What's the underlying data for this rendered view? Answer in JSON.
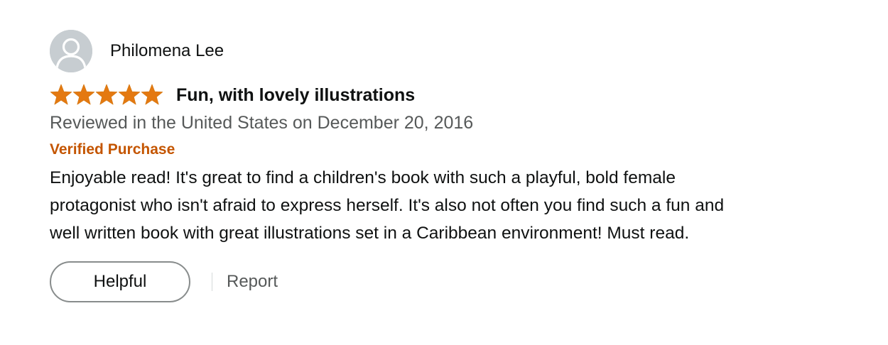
{
  "reviewer": {
    "name": "Philomena Lee",
    "avatar_icon": "default-user-avatar-icon"
  },
  "review": {
    "rating": 5,
    "rating_max": 5,
    "star_icon": "star-icon",
    "star_color": "#e47911",
    "title": "Fun, with lovely illustrations",
    "date_text": "Reviewed in the United States on December 20, 2016",
    "verified_label": "Verified Purchase",
    "verified_color": "#c45500",
    "body_lines": [
      "Enjoyable read! It's great to find a children's book with such a playful, bold female",
      "protagonist who isn't afraid to express herself. It's also not often you find such a fun and",
      "well written book with great illustrations set in a Caribbean environment! Must read."
    ]
  },
  "actions": {
    "helpful_label": "Helpful",
    "report_label": "Report"
  }
}
